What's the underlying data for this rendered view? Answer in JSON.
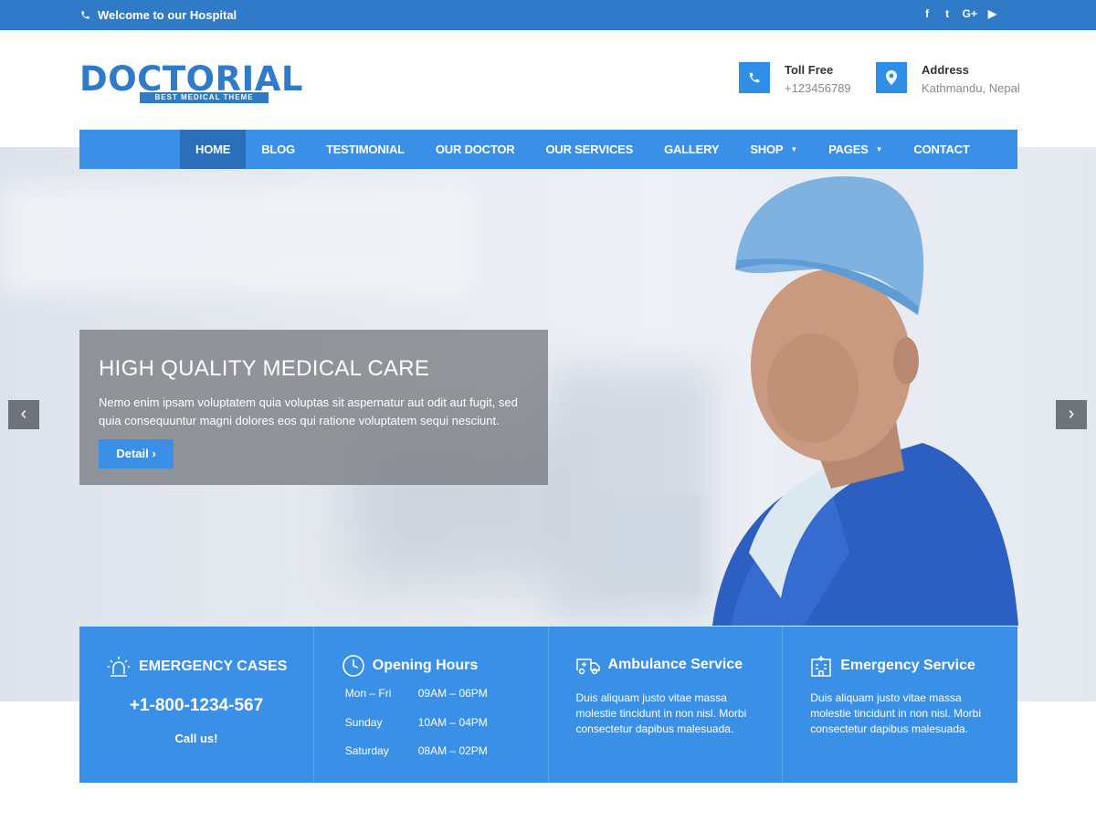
{
  "topbar": {
    "welcome": "Welcome to our Hospital",
    "social": [
      {
        "icon": "facebook-icon",
        "glyph": "f"
      },
      {
        "icon": "twitter-icon",
        "glyph": "t"
      },
      {
        "icon": "google-plus-icon",
        "glyph": "G+"
      },
      {
        "icon": "youtube-icon",
        "glyph": "▶"
      }
    ]
  },
  "logo": {
    "text": "DOCTORIAL",
    "tagline": "BEST MEDICAL THEME"
  },
  "contacts": [
    {
      "title": "Toll Free",
      "value": "+123456789",
      "icon": "phone-icon"
    },
    {
      "title": "Address",
      "value": "Kathmandu, Nepal",
      "icon": "map-pin-icon"
    }
  ],
  "nav": {
    "items": [
      {
        "label": "HOME",
        "active": true
      },
      {
        "label": "BLOG"
      },
      {
        "label": "TESTIMONIAL"
      },
      {
        "label": "OUR DOCTOR"
      },
      {
        "label": "OUR SERVICES"
      },
      {
        "label": "GALLERY"
      },
      {
        "label": "SHOP",
        "dropdown": true
      },
      {
        "label": "PAGES",
        "dropdown": true
      },
      {
        "label": "CONTACT"
      }
    ]
  },
  "slide": {
    "title": "HIGH QUALITY MEDICAL CARE",
    "text": "Nemo enim ipsam voluptatem quia voluptas sit aspernatur aut odit aut fugit, sed quia consequuntur magni dolores eos qui ratione voluptatem sequi nesciunt.",
    "button": "Detail ›",
    "prev": "‹",
    "next": "›"
  },
  "info": {
    "emergency": {
      "title": "EMERGENCY CASES",
      "phone": "+1-800-1234-567",
      "cta": "Call us!"
    },
    "hours": {
      "title": "Opening Hours",
      "rows": [
        {
          "day": "Mon – Fri",
          "time": "09AM – 06PM"
        },
        {
          "day": "Sunday",
          "time": "10AM – 04PM"
        },
        {
          "day": "Saturday",
          "time": "08AM – 02PM"
        }
      ]
    },
    "ambulance": {
      "title": "Ambulance Service",
      "text": "Duis aliquam justo vitae massa molestie tincidunt in non nisl. Morbi consectetur dapibus malesuada."
    },
    "service": {
      "title": "Emergency Service",
      "text": "Duis aliquam justo vitae massa molestie tincidunt in non nisl. Morbi consectetur dapibus malesuada."
    }
  },
  "colors": {
    "primary": "#3a8fe6",
    "topbar": "#2f7bc7",
    "active_nav": "#2a6fb7"
  }
}
